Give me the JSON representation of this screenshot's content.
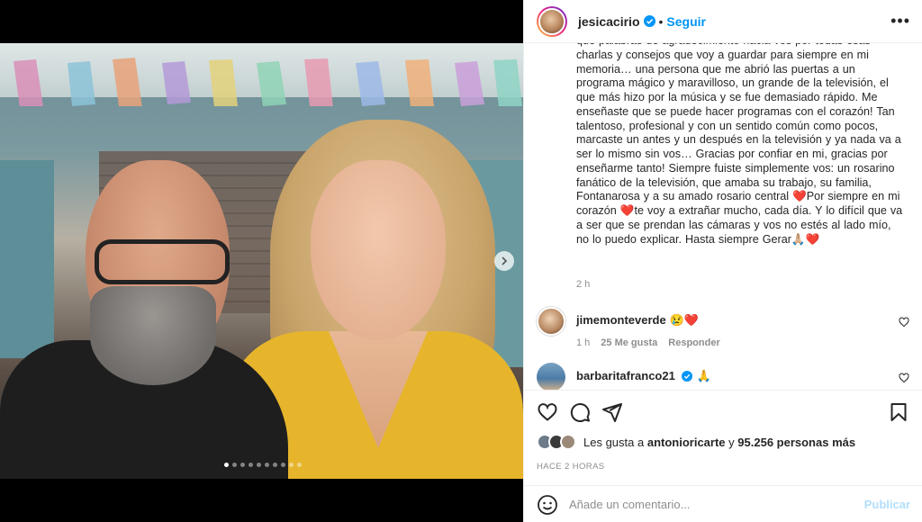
{
  "post": {
    "username": "jesicacirio",
    "separator": "•",
    "follow_label": "Seguir",
    "more_label": "•••",
    "caption": "que palabras de agradecimiento hacia vos por todas esas charlas y consejos que voy a guardar para siempre en mi memoria… una persona que me abrió las puertas a un programa mágico y maravilloso, un grande de la televisión, el que más hizo por la música y se fue demasiado rápido. Me enseñaste que se puede hacer programas con el corazón! Tan talentoso, profesional y con un sentido común como pocos, marcaste un antes y un después en la televisión y ya nada va a ser lo mismo sin vos… Gracias por confiar en mi, gracias por enseñarme tanto! Siempre fuiste simplemente vos: un rosarino fanático de la televisión, que amaba su trabajo, su familia, Fontanarosa y a su amado rosario central ❤️Por siempre en mi corazón ❤️te voy a extrañar mucho, cada día. Y lo difícil que va a ser que se prendan las cámaras y vos no estés al lado mío, no lo puedo explicar. Hasta siempre Gerar🙏🏼❤️",
    "caption_time": "2 h",
    "carousel": {
      "slides": 10,
      "active_index": 0
    }
  },
  "comments": [
    {
      "username": "jimemonteverde",
      "text": "😢❤️",
      "time": "1 h",
      "likes": "25 Me gusta",
      "reply_label": "Responder"
    },
    {
      "username": "barbaritafranco21",
      "text": "🙏",
      "verified": true
    }
  ],
  "actions": {
    "icons": [
      "heart-icon",
      "comment-icon",
      "share-icon",
      "bookmark-icon"
    ],
    "likes_prefix": "Les gusta a",
    "likes_user": "antonioricarte",
    "likes_and": "y",
    "likes_count": "95.256 personas más",
    "posted_ago": "HACE 2 HORAS",
    "comment_placeholder": "Añade un comentario...",
    "publish_label": "Publicar"
  },
  "colors": {
    "accent": "#0095f6",
    "publish_disabled": "#b2dffc",
    "muted": "#8e8e8e",
    "text": "#262626",
    "heart_red": "#e0245e"
  }
}
